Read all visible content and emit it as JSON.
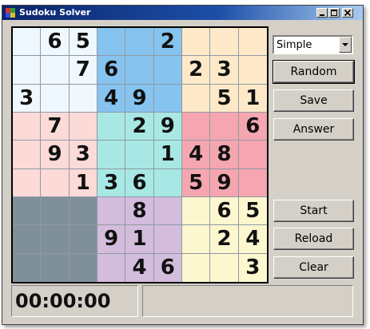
{
  "window": {
    "title": "Sudoku Solver"
  },
  "board": {
    "cells": [
      [
        "",
        "6",
        "5",
        "",
        "",
        "2",
        "",
        "",
        ""
      ],
      [
        "",
        "",
        "7",
        "6",
        "",
        "",
        "2",
        "3",
        ""
      ],
      [
        "3",
        "",
        "",
        "4",
        "9",
        "",
        "",
        "5",
        "1"
      ],
      [
        "",
        "7",
        "",
        "",
        "2",
        "9",
        "",
        "",
        "6"
      ],
      [
        "",
        "9",
        "3",
        "",
        "",
        "1",
        "4",
        "8",
        ""
      ],
      [
        "",
        "",
        "1",
        "3",
        "6",
        "",
        "5",
        "9",
        ""
      ],
      [
        "",
        "",
        "",
        "",
        "8",
        "",
        "",
        "6",
        "5"
      ],
      [
        "",
        "",
        "",
        "9",
        "1",
        "",
        "",
        "2",
        "4"
      ],
      [
        "",
        "",
        "",
        "",
        "4",
        "6",
        "",
        "",
        "3"
      ]
    ],
    "box_colors": [
      [
        "#f0f8ff",
        "#87c3ef",
        "#fde9c8"
      ],
      [
        "#fcdad8",
        "#a8e8e4",
        "#f5a6b0"
      ],
      [
        "#7f909a",
        "#d3bcdc",
        "#fdf7cf"
      ]
    ]
  },
  "controls": {
    "difficulty_value": "Simple",
    "random_label": "Random",
    "save_label": "Save",
    "answer_label": "Answer",
    "start_label": "Start",
    "reload_label": "Reload",
    "clear_label": "Clear"
  },
  "status": {
    "timer": "00:00:00",
    "message": ""
  }
}
